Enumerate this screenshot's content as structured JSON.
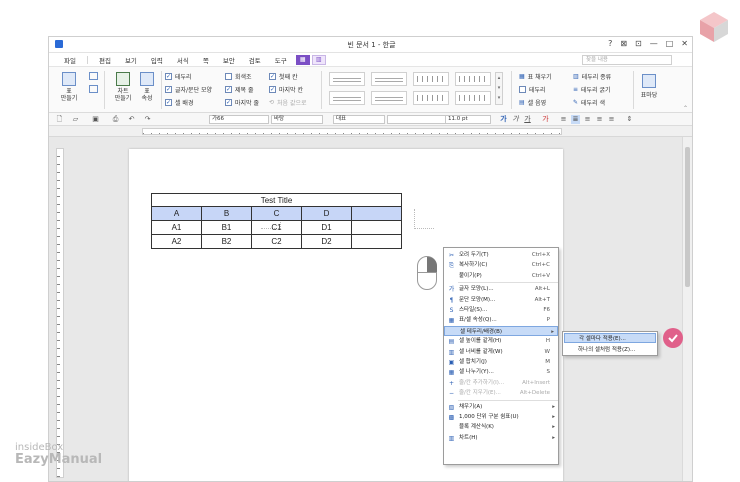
{
  "window": {
    "title": "빈 문서 1 - 한글"
  },
  "titlebar_controls": [
    "?",
    "⊠",
    "⊡",
    "—",
    "□",
    "✕"
  ],
  "menu": [
    "파일",
    "편집",
    "보기",
    "입력",
    "서식",
    "쪽",
    "보안",
    "검토",
    "도구"
  ],
  "search": {
    "placeholder": "찾을 내용"
  },
  "ribbon": {
    "table_make": "표\n만들기",
    "chart_make": "차트\n만들기",
    "table_props": "표\n속성",
    "checks": [
      {
        "label": "테두리",
        "checked": true
      },
      {
        "label": "글자/문단 모양",
        "checked": true
      },
      {
        "label": "셀 배경",
        "checked": true
      },
      {
        "label": "회색조",
        "checked": false
      },
      {
        "label": "제목 줄",
        "checked": true
      },
      {
        "label": "마지막 줄",
        "checked": true
      },
      {
        "label": "첫째 칸",
        "checked": true
      },
      {
        "label": "마지막 칸",
        "checked": true
      },
      {
        "label": "처음 값으로",
        "checked": false,
        "disabled": true
      }
    ],
    "right_items": [
      "표 채우기",
      "테두리",
      "셀 음영",
      "테두리 종류",
      "테두리 굵기",
      "테두리 색"
    ],
    "caption": "표마당"
  },
  "toolbar": {
    "style": "바탕",
    "style_prefix": "가66",
    "lang": "대표",
    "font": "",
    "size": "11.0",
    "unit": "pt"
  },
  "table": {
    "title": "Test Title",
    "headers": [
      "A",
      "B",
      "C",
      "D",
      ""
    ],
    "rows": [
      [
        "A1",
        "B1",
        "C1",
        "D1",
        ""
      ],
      [
        "A2",
        "B2",
        "C2",
        "D2",
        ""
      ]
    ]
  },
  "context_menu": [
    {
      "icon": "cut-icon",
      "glyph": "✂",
      "label": "오려 두기(T)",
      "shortcut": "Ctrl+X"
    },
    {
      "icon": "copy-icon",
      "glyph": "⎘",
      "label": "복사하기(C)",
      "shortcut": "Ctrl+C"
    },
    {
      "icon": "",
      "glyph": "",
      "label": "붙이기(P)",
      "shortcut": "Ctrl+V"
    },
    {
      "sep": true
    },
    {
      "icon": "char-shape-icon",
      "glyph": "가",
      "label": "글자 모양(L)...",
      "shortcut": "Alt+L"
    },
    {
      "icon": "para-shape-icon",
      "glyph": "¶",
      "label": "문단 모양(M)...",
      "shortcut": "Alt+T"
    },
    {
      "icon": "style-icon",
      "glyph": "S",
      "label": "스타일(S)...",
      "shortcut": "F6"
    },
    {
      "icon": "table-props-icon",
      "glyph": "▦",
      "label": "표/셀 속성(Q)...",
      "shortcut": "P"
    },
    {
      "label": "셀 테두리/배경(B)",
      "submenu": true,
      "highlight": true
    },
    {
      "icon": "row-height-icon",
      "glyph": "▤",
      "label": "셀 높이를 같게(H)",
      "shortcut": "H"
    },
    {
      "icon": "col-width-icon",
      "glyph": "▥",
      "label": "셀 너비를 같게(W)",
      "shortcut": "W"
    },
    {
      "icon": "merge-icon",
      "glyph": "▣",
      "label": "셀 합치기(J)",
      "shortcut": "M"
    },
    {
      "icon": "split-icon",
      "glyph": "▦",
      "label": "셀 나누기(Y)...",
      "shortcut": "S"
    },
    {
      "icon": "insert-icon",
      "glyph": "+",
      "label": "줄/칸 추가하기(I)...",
      "shortcut": "Alt+Insert",
      "disabled": true
    },
    {
      "icon": "delete-icon",
      "glyph": "−",
      "label": "줄/칸 지우기(E)...",
      "shortcut": "Alt+Delete",
      "disabled": true
    },
    {
      "sep": true
    },
    {
      "icon": "fill-icon",
      "glyph": "▧",
      "label": "채우기(A)",
      "submenu": true
    },
    {
      "icon": "thousands-icon",
      "glyph": "▩",
      "label": "1,000 단위 구분 쉼표(U)",
      "submenu": true
    },
    {
      "icon": "",
      "glyph": "",
      "label": "블록 계산식(K)",
      "submenu": true
    },
    {
      "icon": "chart-icon",
      "glyph": "▥",
      "label": "차트(H)",
      "submenu": true
    }
  ],
  "submenu": [
    "각 셀마다 적용(E)...",
    "하나의 셀처럼 적용(Z)..."
  ],
  "brand": {
    "line1": "insideBox",
    "line2": "EazyManual"
  },
  "colors": {
    "accent": "#7b4fc5",
    "selection": "#c7d6f7",
    "highlight": "#c7dbf7",
    "check": "#e0608a"
  }
}
